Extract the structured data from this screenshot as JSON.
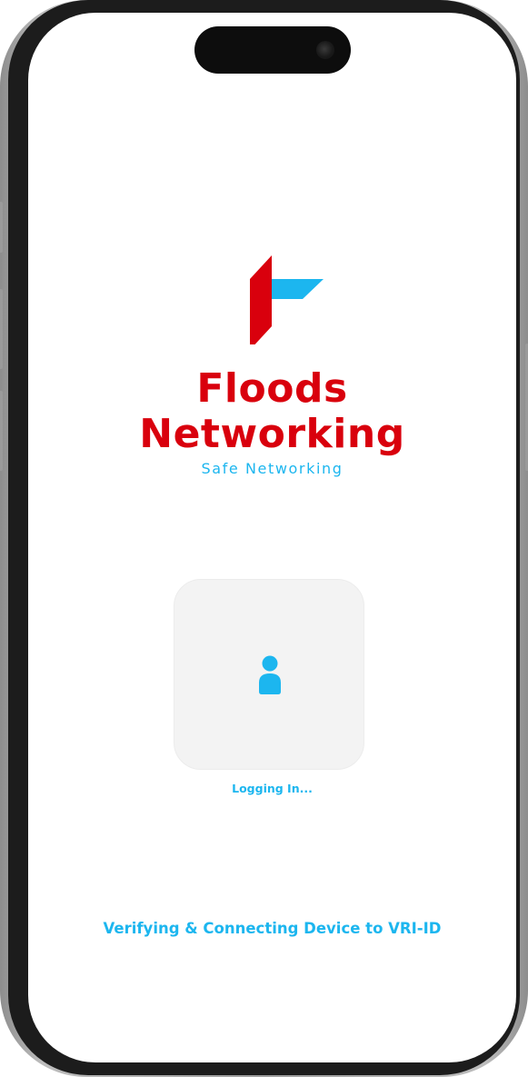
{
  "device": {
    "frame": "phone"
  },
  "brand": {
    "line1": "Floods",
    "line2": "Networking",
    "tagline": "Safe Networking",
    "logo_icon": "floods-networking-logo",
    "colors": {
      "red": "#d9000d",
      "blue": "#1cb6ef"
    }
  },
  "login": {
    "icon": "user-icon",
    "status": "Logging In..."
  },
  "footer": {
    "message": "Verifying & Connecting Device to VRI-ID"
  }
}
